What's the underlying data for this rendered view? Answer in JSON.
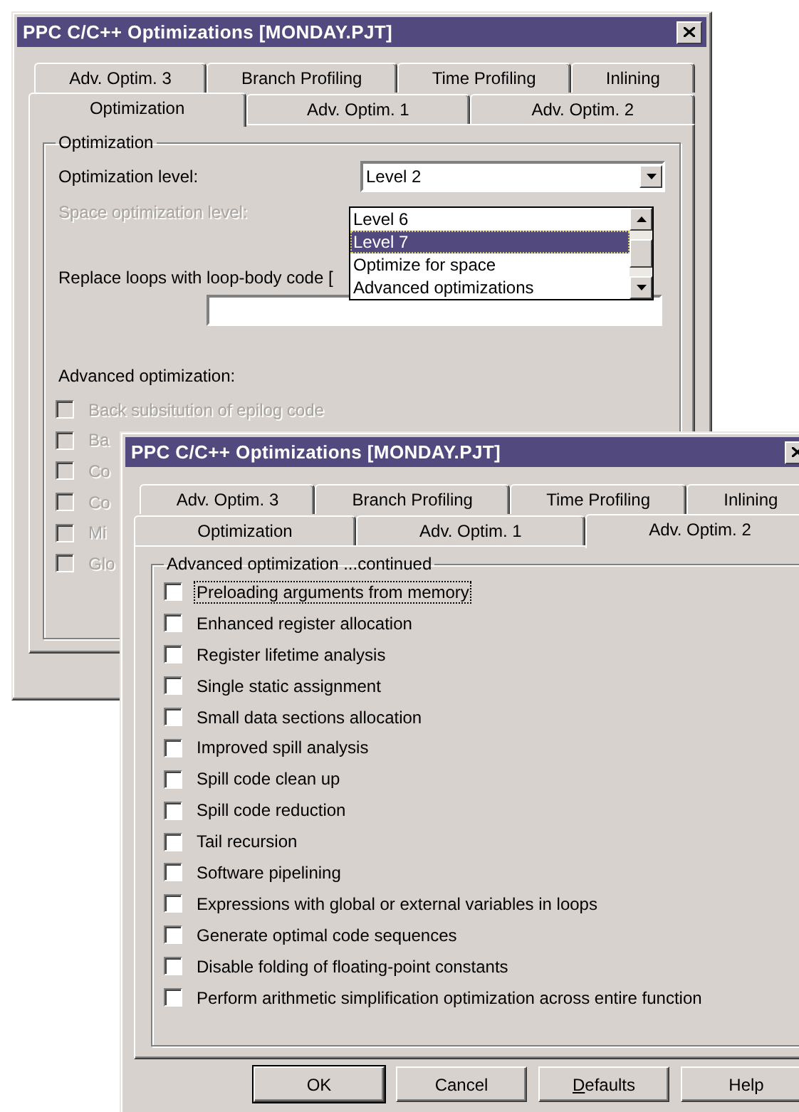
{
  "back_window": {
    "title": "PPC C/C++ Optimizations [MONDAY.PJT]",
    "tab_rows": [
      [
        {
          "label": "Adv. Optim. 3",
          "selected": false
        },
        {
          "label": "Branch Profiling",
          "selected": false
        },
        {
          "label": "Time Profiling",
          "selected": false
        },
        {
          "label": "Inlining",
          "selected": false
        }
      ],
      [
        {
          "label": "Optimization",
          "selected": true
        },
        {
          "label": "Adv. Optim. 1",
          "selected": false
        },
        {
          "label": "Adv. Optim. 2",
          "selected": false
        }
      ]
    ],
    "group_title": "Optimization",
    "optimization_level": {
      "label": "Optimization level:",
      "value": "Level 2"
    },
    "space_level": {
      "label": "Space optimization level:",
      "disabled": true
    },
    "dropdown_list": [
      {
        "label": "Level 6",
        "selected": false
      },
      {
        "label": "Level 7",
        "selected": true
      },
      {
        "label": "Optimize for space",
        "selected": false
      },
      {
        "label": "Advanced optimizations",
        "selected": false
      }
    ],
    "replace_loops": {
      "label": "Replace loops with loop-body code ["
    },
    "advanced_label": "Advanced optimization:",
    "options": [
      {
        "label": "Back subsitution of epilog code",
        "checked": false,
        "disabled": true
      },
      {
        "label": "Ba",
        "checked": false,
        "disabled": true
      },
      {
        "label": "Co",
        "checked": false,
        "disabled": true
      },
      {
        "label": "Co",
        "checked": false,
        "disabled": true
      },
      {
        "label": "Mi",
        "checked": false,
        "disabled": true
      },
      {
        "label": "Glo",
        "checked": false,
        "disabled": true
      }
    ]
  },
  "front_window": {
    "title": "PPC C/C++ Optimizations [MONDAY.PJT]",
    "tab_rows": [
      [
        {
          "label": "Adv. Optim. 3",
          "selected": false
        },
        {
          "label": "Branch Profiling",
          "selected": false
        },
        {
          "label": "Time Profiling",
          "selected": false
        },
        {
          "label": "Inlining",
          "selected": false
        }
      ],
      [
        {
          "label": "Optimization",
          "selected": false
        },
        {
          "label": "Adv. Optim. 1",
          "selected": false
        },
        {
          "label": "Adv. Optim. 2",
          "selected": true
        }
      ]
    ],
    "group_title": "Advanced optimization ...continued",
    "options": [
      {
        "label": "Preloading arguments from memory",
        "checked": false,
        "focused": true
      },
      {
        "label": "Enhanced register allocation",
        "checked": false,
        "focused": false
      },
      {
        "label": "Register lifetime analysis",
        "checked": false,
        "focused": false
      },
      {
        "label": "Single static assignment",
        "checked": false,
        "focused": false
      },
      {
        "label": "Small data sections allocation",
        "checked": false,
        "focused": false
      },
      {
        "label": "Improved spill analysis",
        "checked": false,
        "focused": false
      },
      {
        "label": "Spill code clean up",
        "checked": false,
        "focused": false
      },
      {
        "label": "Spill code reduction",
        "checked": false,
        "focused": false
      },
      {
        "label": "Tail recursion",
        "checked": false,
        "focused": false
      },
      {
        "label": "Software pipelining",
        "checked": false,
        "focused": false
      },
      {
        "label": "Expressions with global or external variables in loops",
        "checked": false,
        "focused": false
      },
      {
        "label": "Generate optimal code sequences",
        "checked": false,
        "focused": false
      },
      {
        "label": "Disable folding of floating-point constants",
        "checked": false,
        "focused": false
      },
      {
        "label": "Perform arithmetic simplification optimization across entire function",
        "checked": false,
        "focused": false
      }
    ],
    "buttons": [
      {
        "label": "OK",
        "mnemonic": false
      },
      {
        "label": "Cancel",
        "mnemonic": false
      },
      {
        "label": "Defaults",
        "mnemonic": true
      },
      {
        "label": "Help",
        "mnemonic": false
      }
    ]
  }
}
